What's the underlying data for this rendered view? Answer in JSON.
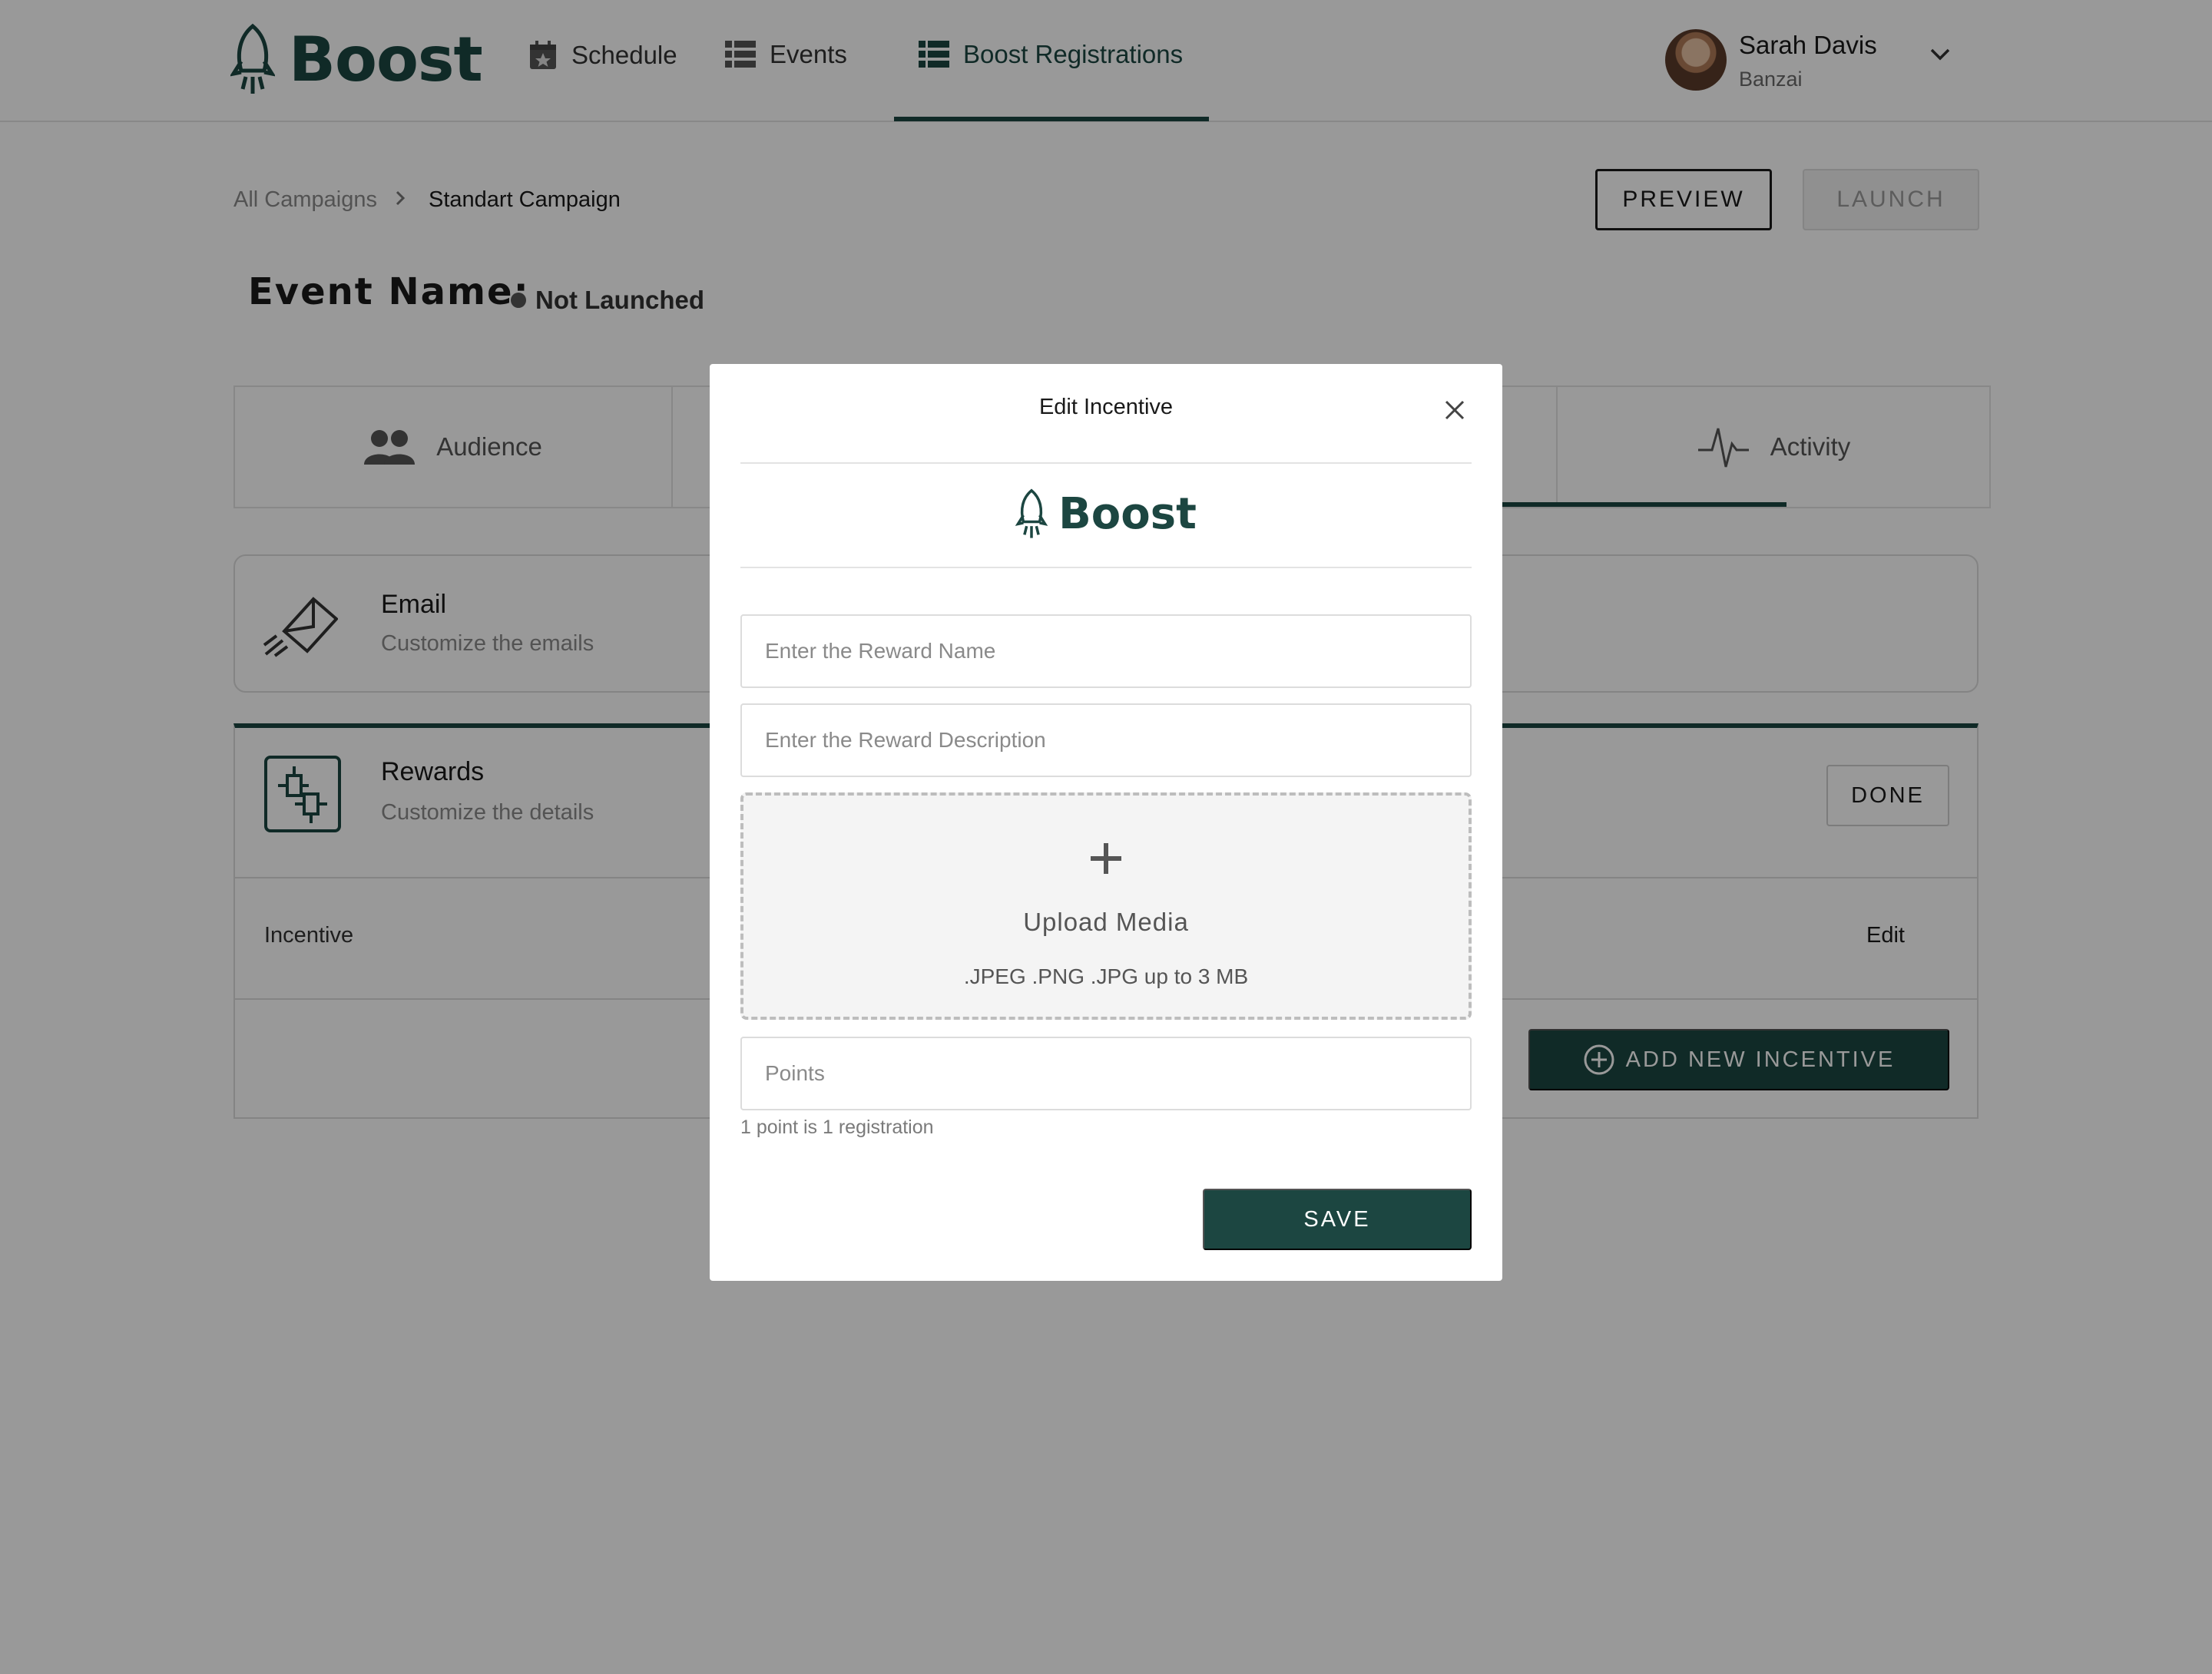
{
  "header": {
    "brand": "Boost",
    "nav": [
      {
        "label": "Schedule",
        "icon": "calendar-star-icon"
      },
      {
        "label": "Events",
        "icon": "list-icon"
      },
      {
        "label": "Boost Registrations",
        "icon": "list-icon",
        "active": true
      }
    ],
    "user": {
      "name": "Sarah Davis",
      "org": "Banzai"
    }
  },
  "breadcrumb": {
    "parent": "All Campaigns",
    "current": "Standart Campaign"
  },
  "actions": {
    "preview": "PREVIEW",
    "launch": "LAUNCH"
  },
  "event": {
    "title": "Event Name:",
    "status": "Not Launched"
  },
  "tabs": [
    {
      "label": "Audience",
      "icon": "users-icon"
    },
    {
      "label": "Activity",
      "icon": "pulse-icon"
    }
  ],
  "email_card": {
    "title": "Email",
    "subtitle": "Customize the emails"
  },
  "rewards_card": {
    "title": "Rewards",
    "subtitle": "Customize the details",
    "done": "DONE",
    "incentive_label": "Incentive",
    "edit": "Edit",
    "add_new": "ADD NEW INCENTIVE"
  },
  "modal": {
    "title": "Edit Incentive",
    "brand": "Boost",
    "reward_name": {
      "value": "",
      "placeholder": "Enter the Reward Name"
    },
    "reward_description": {
      "value": "",
      "placeholder": "Enter the Reward Description"
    },
    "upload": {
      "title": "Upload Media",
      "types": ".JPEG .PNG .JPG up to 3 MB"
    },
    "points": {
      "value": "",
      "placeholder": "Points"
    },
    "hint": "1 point is 1 registration",
    "save": "SAVE"
  },
  "colors": {
    "brand": "#1c4641",
    "overlay": "rgba(0,0,0,0.40)",
    "muted": "#8a8a8a"
  }
}
